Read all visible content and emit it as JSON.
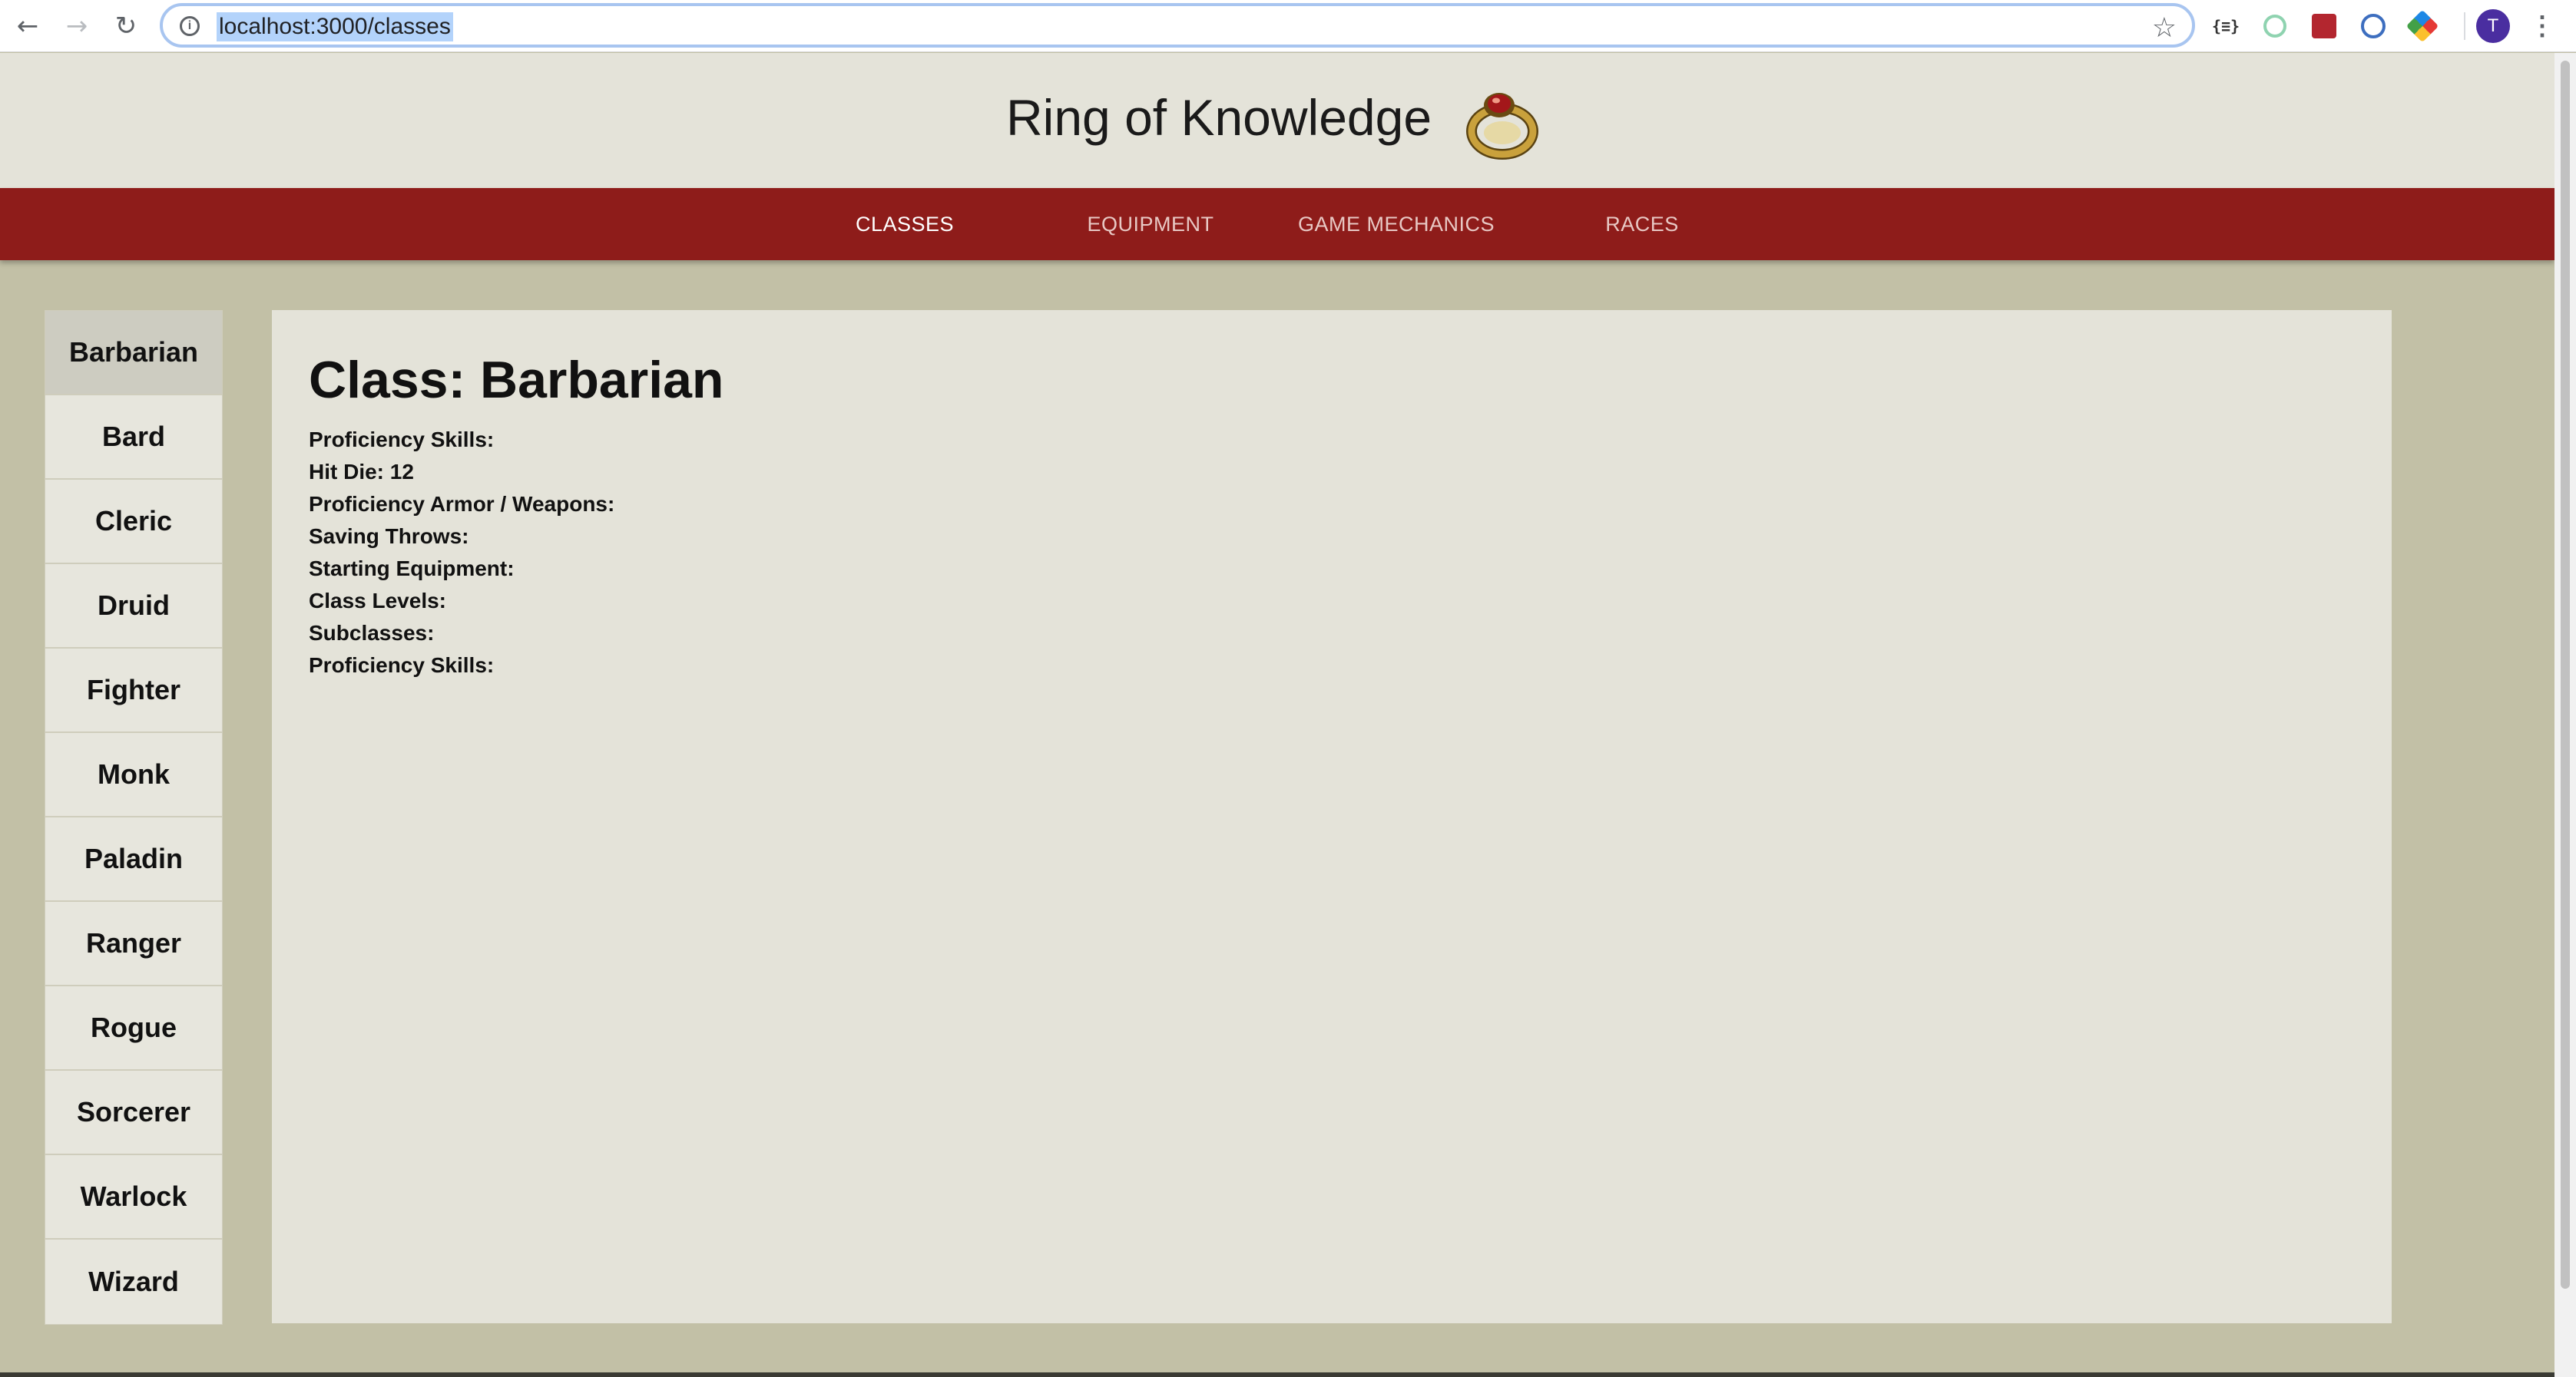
{
  "browser": {
    "url": "localhost:3000/classes",
    "back_icon": "←",
    "forward_icon": "→",
    "reload_icon": "↻",
    "star_icon": "☆",
    "json_ext_label": "{≡}",
    "avatar_initial": "T",
    "menu_icon": "⋮"
  },
  "header": {
    "title": "Ring of Knowledge",
    "logo": "ring-icon"
  },
  "nav": {
    "items": [
      {
        "label": "CLASSES"
      },
      {
        "label": "EQUIPMENT"
      },
      {
        "label": "GAME MECHANICS"
      },
      {
        "label": "RACES"
      }
    ],
    "active": "CLASSES"
  },
  "sidebar": {
    "items": [
      {
        "label": "Barbarian"
      },
      {
        "label": "Bard"
      },
      {
        "label": "Cleric"
      },
      {
        "label": "Druid"
      },
      {
        "label": "Fighter"
      },
      {
        "label": "Monk"
      },
      {
        "label": "Paladin"
      },
      {
        "label": "Ranger"
      },
      {
        "label": "Rogue"
      },
      {
        "label": "Sorcerer"
      },
      {
        "label": "Warlock"
      },
      {
        "label": "Wizard"
      }
    ],
    "active": "Barbarian"
  },
  "content": {
    "heading": "Class: Barbarian",
    "fields": [
      "Proficiency Skills:",
      "Hit Die: 12",
      "Proficiency Armor / Weapons:",
      "Saving Throws:",
      "Starting Equipment:",
      "Class Levels:",
      "Subclasses:",
      "Proficiency Skills:"
    ]
  },
  "colors": {
    "navbar": "#8e1c1a",
    "header_bg": "#e4e3d9",
    "page_bg": "#c2c0a6",
    "active_side": "#cdccc1"
  }
}
